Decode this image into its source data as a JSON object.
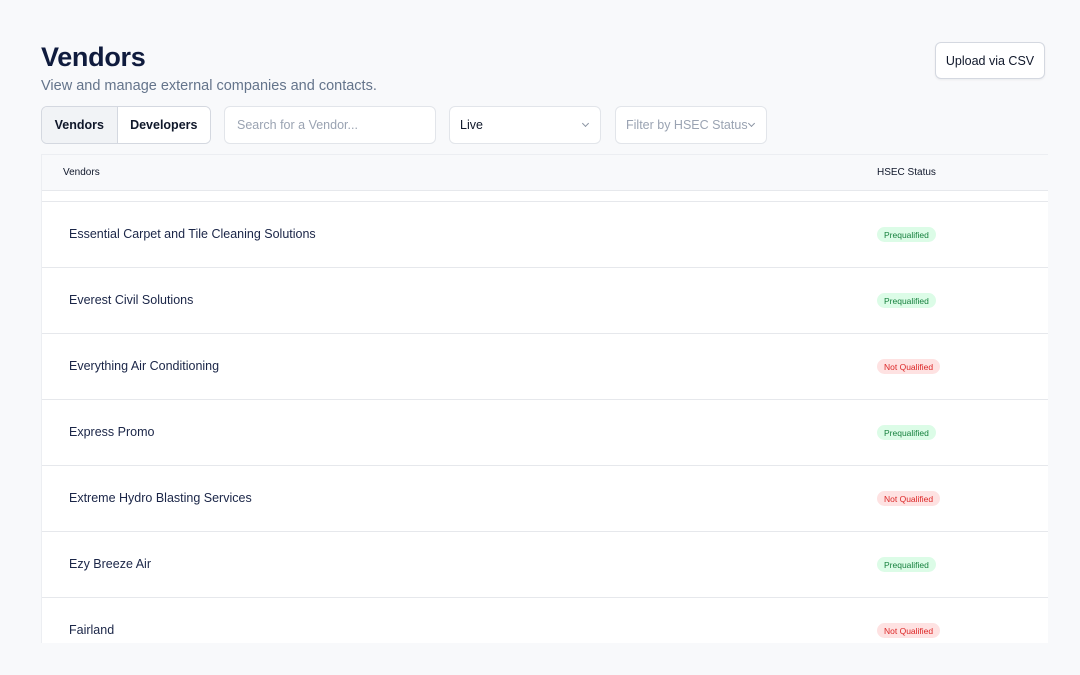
{
  "header": {
    "title": "Vendors",
    "subtitle": "View and manage external companies and contacts.",
    "upload_label": "Upload via CSV"
  },
  "tabs": [
    {
      "label": "Vendors",
      "active": true
    },
    {
      "label": "Developers",
      "active": false
    }
  ],
  "filters": {
    "search_placeholder": "Search for a Vendor...",
    "status_value": "Live",
    "hsec_placeholder": "Filter by HSEC Status"
  },
  "table": {
    "columns": [
      "Vendors",
      "HSEC Status"
    ],
    "rows": [
      {
        "name": "Essential Carpet and Tile Cleaning Solutions",
        "status": "Prequalified"
      },
      {
        "name": "Everest Civil Solutions",
        "status": "Prequalified"
      },
      {
        "name": "Everything Air Conditioning",
        "status": "Not Qualified"
      },
      {
        "name": "Express Promo",
        "status": "Prequalified"
      },
      {
        "name": "Extreme Hydro Blasting Services",
        "status": "Not Qualified"
      },
      {
        "name": "Ezy Breeze Air",
        "status": "Prequalified"
      },
      {
        "name": "Fairland",
        "status": "Not Qualified"
      }
    ]
  },
  "colors": {
    "prequalified_bg": "#dcfce7",
    "prequalified_text": "#15803d",
    "not_qualified_bg": "#fee2e2",
    "not_qualified_text": "#dc2626"
  }
}
